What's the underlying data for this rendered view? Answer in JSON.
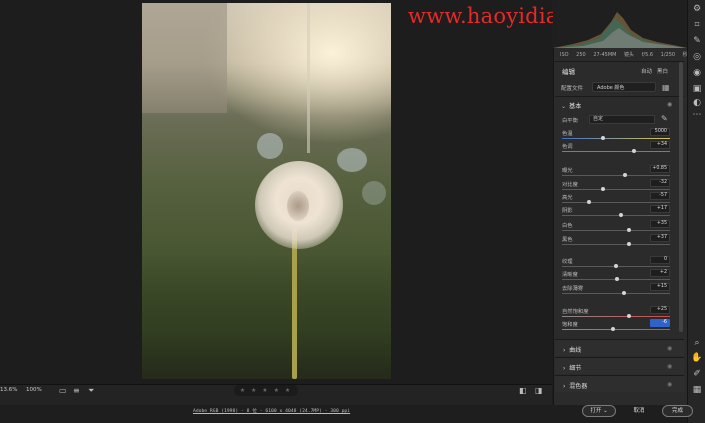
{
  "watermark": "www.haoyidianshell.com",
  "histogram_meta": {
    "iso": "ISO 250",
    "lens": "27-45MM 镜头",
    "aperture": "f/5.6",
    "shutter": "1/250 秒"
  },
  "edit_panel": {
    "title": "编辑",
    "auto_label": "自动",
    "bw_label": "黑白",
    "profile_label": "配置文件",
    "profile_value": "Adobe 颜色",
    "basic_section": "基本",
    "wb_label": "白平衡",
    "wb_value": "自定",
    "sliders": [
      {
        "label": "色温",
        "value": "5000",
        "pos": 0.38
      },
      {
        "label": "色调",
        "value": "+34",
        "pos": 0.67
      },
      {
        "label": "曝光",
        "value": "+0.85",
        "pos": 0.58
      },
      {
        "label": "对比度",
        "value": "-32",
        "pos": 0.38
      },
      {
        "label": "高光",
        "value": "-57",
        "pos": 0.25
      },
      {
        "label": "阴影",
        "value": "+17",
        "pos": 0.55
      },
      {
        "label": "白色",
        "value": "+35",
        "pos": 0.62
      },
      {
        "label": "黑色",
        "value": "+37",
        "pos": 0.62
      },
      {
        "label": "纹理",
        "value": "0",
        "pos": 0.5
      },
      {
        "label": "清晰度",
        "value": "+2",
        "pos": 0.51
      },
      {
        "label": "去除薄雾",
        "value": "+15",
        "pos": 0.57
      },
      {
        "label": "自然饱和度",
        "value": "+25",
        "pos": 0.62
      },
      {
        "label": "饱和度",
        "value": "-6",
        "pos": 0.47
      }
    ],
    "collapsed_sections": [
      "曲线",
      "细节",
      "混色器"
    ]
  },
  "bottom_bar": {
    "zoom_fit": "13.6%",
    "zoom_100": "100%",
    "rating": "★ ★ ★ ★ ★"
  },
  "footer": {
    "file_info": "Adobe RGB (1998) - 8 位 - 6100 x 4048 (24.7MP) - 300 ppi",
    "open_button": "打开",
    "cancel_button": "取消",
    "done_button": "完成"
  }
}
